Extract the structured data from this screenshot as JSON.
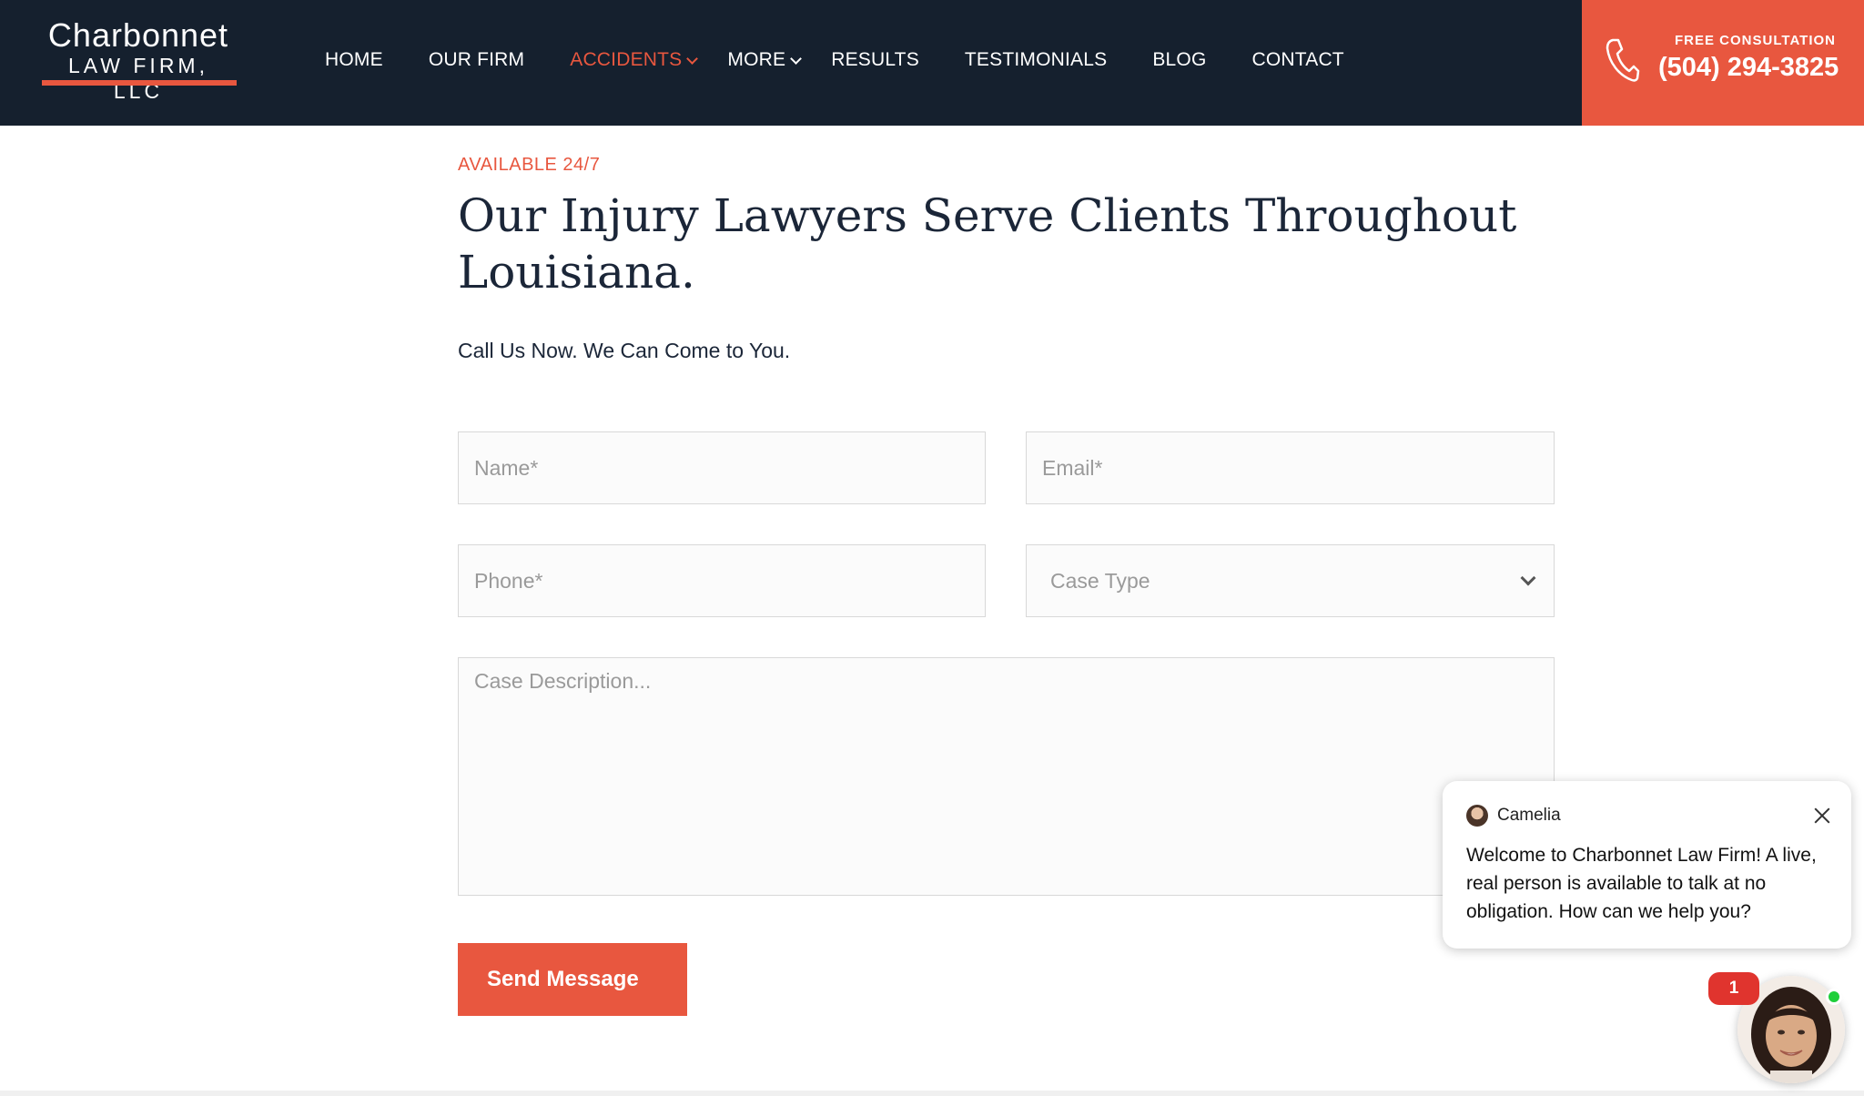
{
  "header": {
    "logo": {
      "name": "Charbonnet",
      "sub": "LAW FIRM, LLC"
    },
    "nav": [
      {
        "label": "HOME",
        "active": false,
        "dropdown": false
      },
      {
        "label": "OUR FIRM",
        "active": false,
        "dropdown": false
      },
      {
        "label": "ACCIDENTS",
        "active": true,
        "dropdown": true
      },
      {
        "label": "MORE",
        "active": false,
        "dropdown": true
      },
      {
        "label": "RESULTS",
        "active": false,
        "dropdown": false
      },
      {
        "label": "TESTIMONIALS",
        "active": false,
        "dropdown": false
      },
      {
        "label": "BLOG",
        "active": false,
        "dropdown": false
      },
      {
        "label": "CONTACT",
        "active": false,
        "dropdown": false
      }
    ],
    "cta": {
      "label": "FREE CONSULTATION",
      "phone": "(504) 294-3825",
      "icon": "phone-icon"
    }
  },
  "main": {
    "eyebrow": "AVAILABLE 24/7",
    "title": "Our Injury Lawyers Serve Clients Throughout Louisiana.",
    "subtitle": "Call Us Now. We Can Come to You."
  },
  "form": {
    "name_placeholder": "Name*",
    "email_placeholder": "Email*",
    "phone_placeholder": "Phone*",
    "case_type": "Case Type",
    "description_placeholder": "Case Description...",
    "submit_label": "Send Message"
  },
  "chat": {
    "agent_name": "Camelia",
    "message": "Welcome to Charbonnet Law Firm! A live, real person is available to talk at no obligation. How can we help you?",
    "unread_count": "1",
    "status": "online"
  },
  "colors": {
    "header_bg": "#15202e",
    "accent": "#e8573f",
    "text": "#1b2638",
    "online": "#1fcf3a",
    "badge": "#e0342e"
  }
}
